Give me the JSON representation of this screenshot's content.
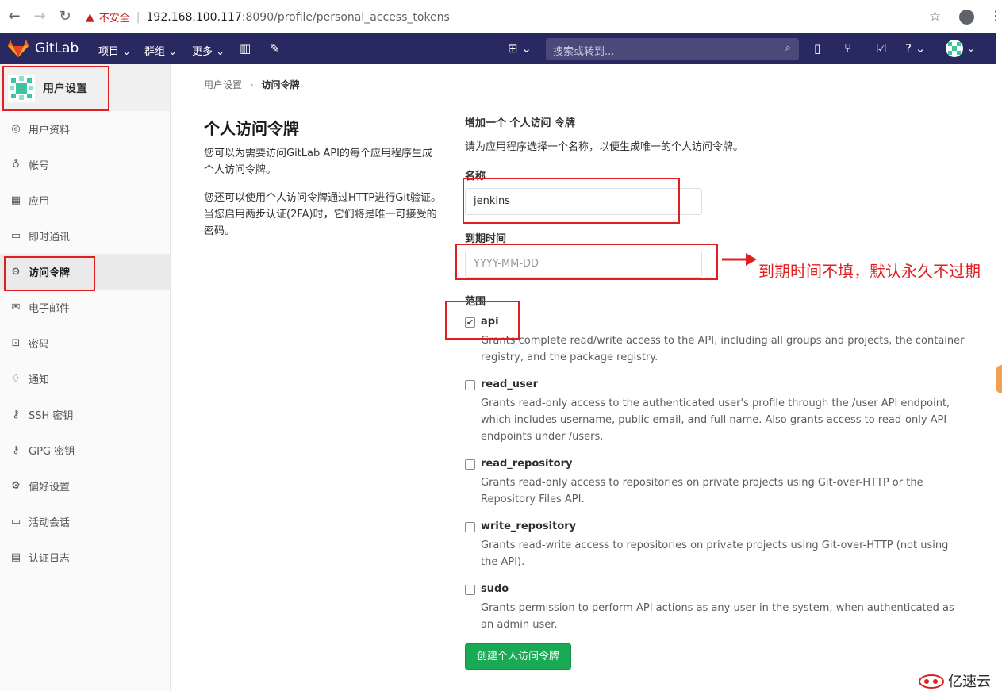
{
  "browser": {
    "security_label": "不安全",
    "url_host": "192.168.100.117",
    "url_rest": ":8090/profile/personal_access_tokens"
  },
  "header": {
    "brand": "GitLab",
    "menu": [
      "项目",
      "群组",
      "更多"
    ],
    "search_placeholder": "搜索或转到..."
  },
  "sidebar": {
    "title": "用户设置",
    "items": [
      {
        "label": "用户资料",
        "icon": "profile-icon",
        "glyph": "◎"
      },
      {
        "label": "帐号",
        "icon": "account-icon",
        "glyph": "♁"
      },
      {
        "label": "应用",
        "icon": "applications-icon",
        "glyph": "▦"
      },
      {
        "label": "即时通讯",
        "icon": "chat-icon",
        "glyph": "▭"
      },
      {
        "label": "访问令牌",
        "icon": "token-icon",
        "glyph": "⊖"
      },
      {
        "label": "电子邮件",
        "icon": "email-icon",
        "glyph": "✉"
      },
      {
        "label": "密码",
        "icon": "lock-icon",
        "glyph": "⊡"
      },
      {
        "label": "通知",
        "icon": "bell-icon",
        "glyph": "♢"
      },
      {
        "label": "SSH 密钥",
        "icon": "key-icon",
        "glyph": "⚷"
      },
      {
        "label": "GPG 密钥",
        "icon": "key-icon",
        "glyph": "⚷"
      },
      {
        "label": "偏好设置",
        "icon": "preferences-icon",
        "glyph": "⚙"
      },
      {
        "label": "活动会话",
        "icon": "monitor-icon",
        "glyph": "▭"
      },
      {
        "label": "认证日志",
        "icon": "log-icon",
        "glyph": "▤"
      }
    ],
    "active_index": 4
  },
  "breadcrumb": {
    "parent": "用户设置",
    "current": "访问令牌"
  },
  "intro": {
    "title": "个人访问令牌",
    "p1": "您可以为需要访问GitLab API的每个应用程序生成个人访问令牌。",
    "p2": "您还可以使用个人访问令牌通过HTTP进行Git验证。 当您启用两步认证(2FA)时，它们将是唯一可接受的密码。"
  },
  "form": {
    "heading": "增加一个 个人访问 令牌",
    "description": "请为应用程序选择一个名称，以便生成唯一的个人访问令牌。",
    "name_label": "名称",
    "name_value": "jenkins",
    "expires_label": "到期时间",
    "expires_placeholder": "YYYY-MM-DD",
    "scopes_label": "范围",
    "scopes": [
      {
        "name": "api",
        "checked": true,
        "desc": "Grants complete read/write access to the API, including all groups and projects, the container registry, and the package registry."
      },
      {
        "name": "read_user",
        "checked": false,
        "desc": "Grants read-only access to the authenticated user's profile through the /user API endpoint, which includes username, public email, and full name. Also grants access to read-only API endpoints under /users."
      },
      {
        "name": "read_repository",
        "checked": false,
        "desc": "Grants read-only access to repositories on private projects using Git-over-HTTP or the Repository Files API."
      },
      {
        "name": "write_repository",
        "checked": false,
        "desc": "Grants read-write access to repositories on private projects using Git-over-HTTP (not using the API)."
      },
      {
        "name": "sudo",
        "checked": false,
        "desc": "Grants permission to perform API actions as any user in the system, when authenticated as an admin user."
      }
    ],
    "submit_label": "创建个人访问令牌"
  },
  "annotation": {
    "text": "到期时间不填，默认永久不过期",
    "color": "#e02020"
  },
  "watermark": "亿速云",
  "colors": {
    "header_bg": "#292961",
    "button_green": "#1aaa55",
    "annotation_red": "#e02020"
  }
}
